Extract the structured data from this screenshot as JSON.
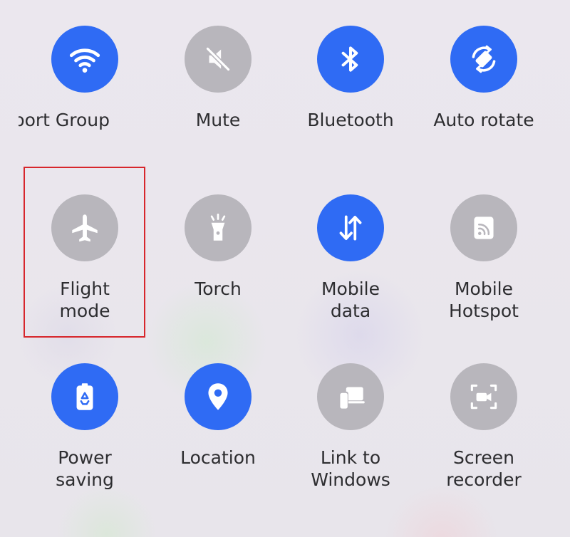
{
  "colors": {
    "tile_on": "#2f6bf4",
    "tile_off": "#b8b6bc",
    "label_text": "#2d2d30",
    "highlight_border": "#d7262c"
  },
  "tiles": [
    {
      "label": "pport Group",
      "state": "on",
      "icon": "wifi-icon"
    },
    {
      "label": "Mute",
      "state": "off",
      "icon": "mute-icon"
    },
    {
      "label": "Bluetooth",
      "state": "on",
      "icon": "bluetooth-icon"
    },
    {
      "label": "Auto rotate",
      "state": "on",
      "icon": "auto-rotate-icon"
    },
    {
      "label": "Flight\nmode",
      "state": "off",
      "icon": "airplane-icon",
      "highlighted": true
    },
    {
      "label": "Torch",
      "state": "off",
      "icon": "flashlight-icon"
    },
    {
      "label": "Mobile\ndata",
      "state": "on",
      "icon": "mobile-data-icon"
    },
    {
      "label": "Mobile\nHotspot",
      "state": "off",
      "icon": "hotspot-icon"
    },
    {
      "label": "Power\nsaving",
      "state": "on",
      "icon": "battery-recycle-icon"
    },
    {
      "label": "Location",
      "state": "on",
      "icon": "location-pin-icon"
    },
    {
      "label": "Link to\nWindows",
      "state": "off",
      "icon": "link-devices-icon"
    },
    {
      "label": "Screen\nrecorder",
      "state": "off",
      "icon": "screen-recorder-icon"
    }
  ]
}
